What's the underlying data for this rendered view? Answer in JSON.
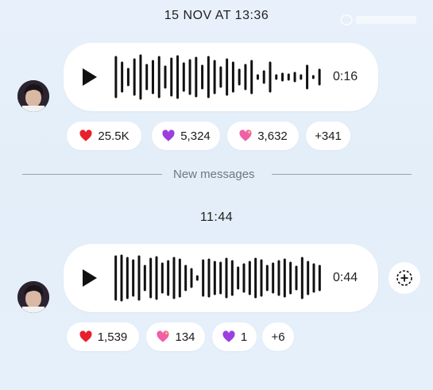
{
  "chat": {
    "timestamp_1": "15 NOV AT 13:36",
    "timestamp_2": "11:44",
    "new_messages_label": "New messages"
  },
  "message_1": {
    "duration": "0:16",
    "reactions": [
      {
        "emoji": "red-heart",
        "count": "25.5K"
      },
      {
        "emoji": "purple-heart",
        "count": "5,324"
      },
      {
        "emoji": "sparkling-heart",
        "count": "3,632"
      },
      {
        "emoji": "",
        "count": "+341"
      }
    ]
  },
  "message_2": {
    "duration": "0:44",
    "reactions": [
      {
        "emoji": "red-heart",
        "count": "1,539"
      },
      {
        "emoji": "sparkling-heart",
        "count": "134"
      },
      {
        "emoji": "purple-heart",
        "count": "1"
      },
      {
        "emoji": "",
        "count": "+6"
      }
    ]
  },
  "icons": {
    "play": "play-icon",
    "add_reaction": "add-reaction-icon",
    "red_heart": "red-heart-icon",
    "purple_heart": "purple-heart-icon",
    "sparkling_heart": "sparkling-heart-icon"
  },
  "colors": {
    "background": "#e6f0fb",
    "bubble": "#ffffff",
    "red_heart": "#e8202c",
    "purple_heart": "#9b3fe0",
    "pink_heart": "#f15fa6",
    "divider": "#9aa3ad"
  }
}
